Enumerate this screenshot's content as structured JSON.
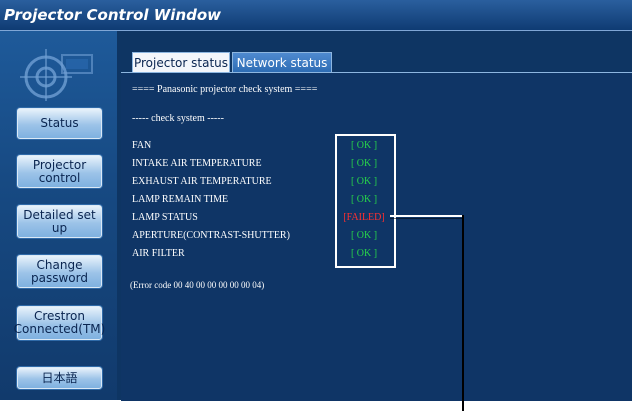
{
  "window": {
    "title": "Projector Control Window"
  },
  "sidebar": {
    "logo_icon": "projector-logo-icon",
    "buttons": [
      {
        "label": "Status"
      },
      {
        "label": "Projector control"
      },
      {
        "label": "Detailed set up"
      },
      {
        "label": "Change password"
      },
      {
        "label": "Crestron Connected(TM)"
      },
      {
        "label": "日本語"
      }
    ]
  },
  "tabs": [
    {
      "label": "Projector status",
      "active": true
    },
    {
      "label": "Network status",
      "active": false
    }
  ],
  "content": {
    "header": "==== Panasonic projector check system ====",
    "subheader": "----- check system -----",
    "items": [
      {
        "name": "FAN",
        "status": "[ OK ]"
      },
      {
        "name": "INTAKE AIR TEMPERATURE",
        "status": "[ OK ]"
      },
      {
        "name": "EXHAUST AIR TEMPERATURE",
        "status": "[ OK ]"
      },
      {
        "name": "LAMP REMAIN TIME",
        "status": "[ OK ]"
      },
      {
        "name": "LAMP STATUS",
        "status": "[FAILED]"
      },
      {
        "name": "APERTURE(CONTRAST-SHUTTER)",
        "status": "[ OK ]"
      },
      {
        "name": "AIR FILTER",
        "status": "[ OK ]"
      }
    ],
    "error_code": "(Error code 00 40 00 00 00 00 00 04)"
  },
  "colors": {
    "ok": "#27d34a",
    "failed": "#ff2f2f",
    "title_bar": "#0f3b73",
    "panel": "#0f3566"
  }
}
